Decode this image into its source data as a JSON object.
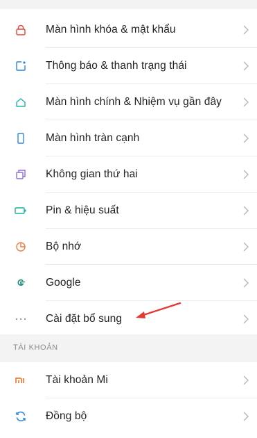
{
  "settings": {
    "items": [
      {
        "label": "Màn hình khóa & mật khẩu",
        "icon": "lock-icon"
      },
      {
        "label": "Thông báo & thanh trạng thái",
        "icon": "notification-icon"
      },
      {
        "label": "Màn hình chính & Nhiệm vụ gần đây",
        "icon": "home-icon"
      },
      {
        "label": "Màn hình tràn cạnh",
        "icon": "phone-icon"
      },
      {
        "label": "Không gian thứ hai",
        "icon": "second-space-icon"
      },
      {
        "label": "Pin & hiệu suất",
        "icon": "battery-icon"
      },
      {
        "label": "Bộ nhớ",
        "icon": "storage-icon"
      },
      {
        "label": "Google",
        "icon": "google-icon"
      },
      {
        "label": "Cài đặt bổ sung",
        "icon": "more-icon"
      }
    ]
  },
  "accounts": {
    "header": "TÀI KHOẢN",
    "items": [
      {
        "label": "Tài khoản Mi",
        "icon": "mi-icon"
      },
      {
        "label": "Đồng bộ",
        "icon": "sync-icon"
      }
    ]
  },
  "colors": {
    "lock": "#e0463b",
    "notification": "#2e86de",
    "home": "#1fb5a8",
    "phone": "#2e86de",
    "second_space": "#8e6fd1",
    "battery": "#19b39b",
    "storage": "#f07f3c",
    "google": "#1f8a7c",
    "more": "#8c8c8c",
    "mi": "#f07f3c",
    "sync": "#2e86de",
    "annotation_arrow": "#e53935"
  }
}
